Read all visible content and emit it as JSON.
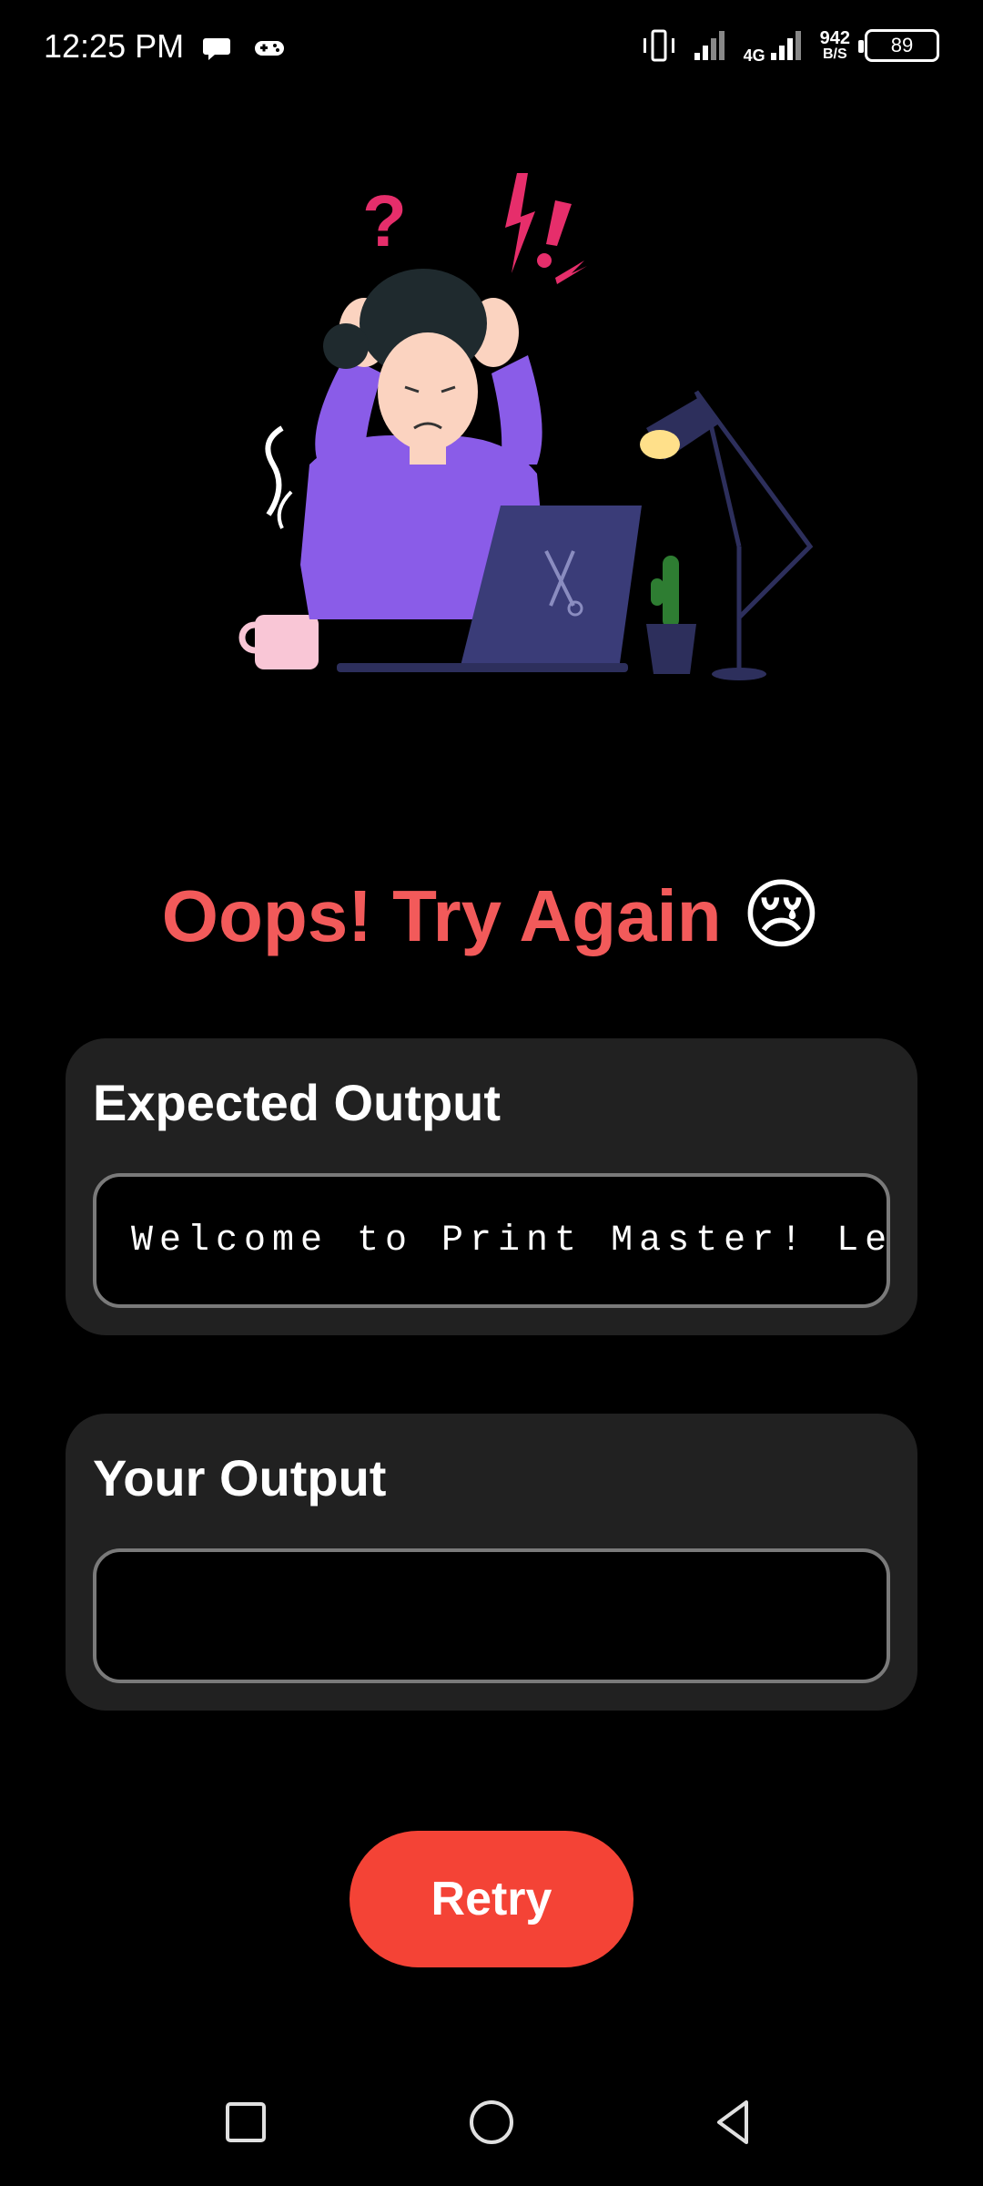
{
  "status_bar": {
    "time": "12:25 PM",
    "network_type": "4G",
    "net_speed_value": "942",
    "net_speed_unit": "B/S",
    "battery": "89",
    "icons": [
      "chat-bubble-icon",
      "gamepad-icon",
      "vibrate-icon",
      "signal-icon",
      "signal-4g-icon",
      "battery-icon"
    ]
  },
  "illustration": {
    "description_icon": "frustrated-person-illustration"
  },
  "result": {
    "title": "Oops! Try Again",
    "emoji": "😢",
    "title_color": "#f25a5a"
  },
  "expected": {
    "label": "Expected Output",
    "value": "Welcome to Print Master! Le"
  },
  "yours": {
    "label": "Your Output",
    "value": ""
  },
  "actions": {
    "retry_label": "Retry",
    "retry_color": "#f44336"
  },
  "nav_bar": {
    "icons": [
      "recent-apps-icon",
      "home-icon",
      "back-icon"
    ]
  }
}
